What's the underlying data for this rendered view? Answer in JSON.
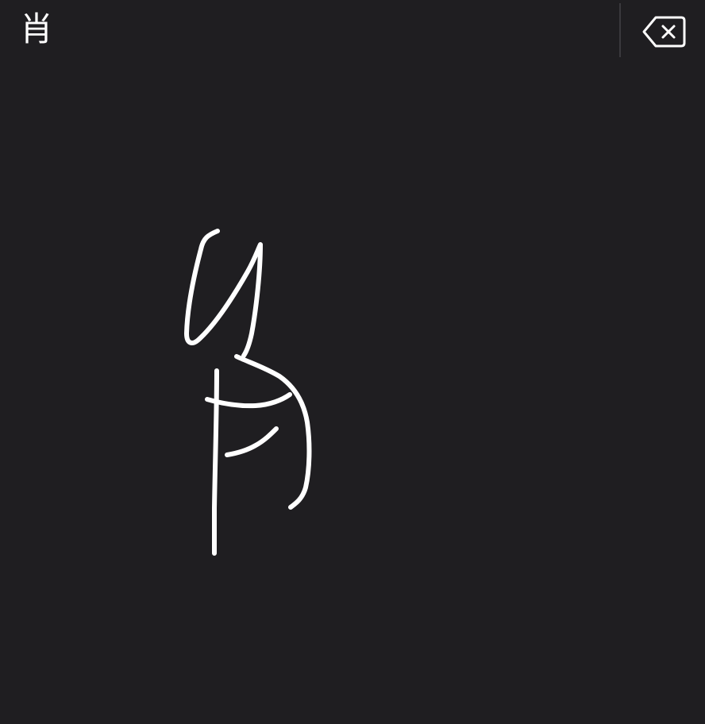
{
  "candidate_bar": {
    "candidates": [
      "肖"
    ]
  },
  "delete_button": {
    "icon": "backspace-icon"
  },
  "drawing_canvas": {
    "stroke_color": "#ffffff",
    "background_color": "#1f1e21"
  }
}
